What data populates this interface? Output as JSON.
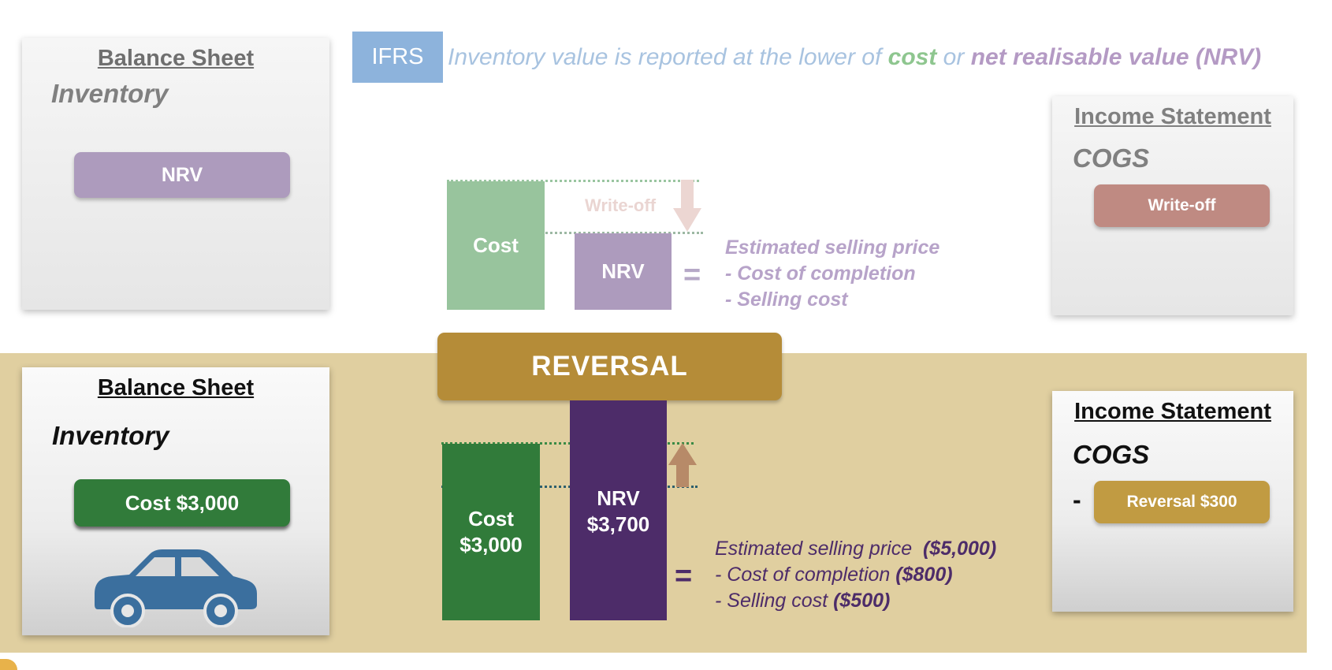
{
  "top": {
    "ifrs_badge": "IFRS",
    "rule": {
      "prefix": "Inventory value is reported at the lower of ",
      "cost": "cost",
      "middle": " or ",
      "nrv": "net realisable value (NRV)"
    },
    "balance_sheet": {
      "title": "Balance Sheet",
      "inventory_label": "Inventory",
      "pill": "NRV"
    },
    "income_statement": {
      "title": "Income Statement",
      "cogs_label": "COGS",
      "pill": "Write-off"
    },
    "bars": {
      "cost_label": "Cost",
      "nrv_label": "NRV",
      "writeoff_label": "Write-off"
    },
    "equals": "=",
    "formula": [
      "Estimated selling price",
      "- Cost of completion",
      "- Selling cost"
    ]
  },
  "reversal_banner": "REVERSAL",
  "bottom": {
    "balance_sheet": {
      "title": "Balance Sheet",
      "inventory_label": "Inventory",
      "pill": "Cost $3,000",
      "car_icon": "car-icon"
    },
    "income_statement": {
      "title": "Income Statement",
      "cogs_label": "COGS",
      "minus": "-",
      "pill": "Reversal $300"
    },
    "bars": {
      "cost_line1": "Cost",
      "cost_line2": "$3,000",
      "nrv_line1": "NRV",
      "nrv_line2": "$3,700"
    },
    "equals": "=",
    "formula": [
      {
        "text": "Estimated selling price",
        "value": "($5,000)"
      },
      {
        "text": "- Cost of completion",
        "value": "($800)"
      },
      {
        "text": "- Selling cost",
        "value": "($500)"
      }
    ]
  },
  "colors": {
    "cost_green_light": "#98c49d",
    "nrv_purple_light": "#ad9bbd",
    "writeoff_pink": "#bf8a82",
    "cost_green_dark": "#317b3a",
    "nrv_purple_dark": "#4d2c69",
    "reversal_gold": "#b58c38",
    "band_tan": "#e0cfa0",
    "ifrs_blue": "#8db3dc"
  }
}
